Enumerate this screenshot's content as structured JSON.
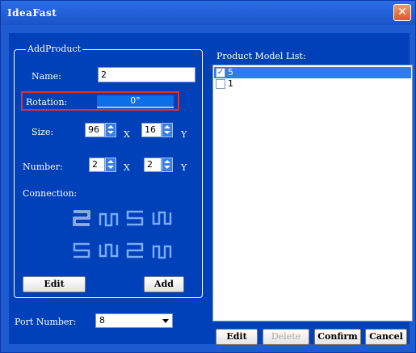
{
  "window": {
    "title": "IdeaFast",
    "close_glyph": "✕"
  },
  "group": {
    "legend": "AddProduct"
  },
  "fields": {
    "name_label": "Name:",
    "name_value": "2",
    "rotation_label": "Rotation:",
    "rotation_value": "0°",
    "size_label": "Size:",
    "size_x": "96",
    "size_y": "16",
    "number_label": "Number:",
    "number_x": "2",
    "number_y": "2",
    "x_label": "X",
    "y_label": "Y",
    "connection_label": "Connection:"
  },
  "connection": {
    "patterns": [
      "zigzag-selected",
      "serpentine-up",
      "s-shape",
      "serpentine-down",
      "s-shape-flipped",
      "serpentine-down-alt",
      "zigzag",
      "serpentine-up-alt"
    ],
    "selected_index": 0,
    "icon_color": "#7aaaf8",
    "selected_color": "#ffffff"
  },
  "buttons": {
    "edit_left": "Edit",
    "add": "Add",
    "edit_right": "Edit",
    "delete": "Delete",
    "confirm": "Confirm",
    "cancel": "Cancel"
  },
  "port": {
    "label": "Port Number:",
    "value": "8"
  },
  "list": {
    "title": "Product Model List:",
    "items": [
      {
        "label": "5",
        "checked": true,
        "selected": true
      },
      {
        "label": "1",
        "checked": false,
        "selected": false
      }
    ]
  },
  "colors": {
    "background": "#0040b8",
    "highlight_border": "#e03030",
    "selected_row": "#2f7bf0"
  }
}
